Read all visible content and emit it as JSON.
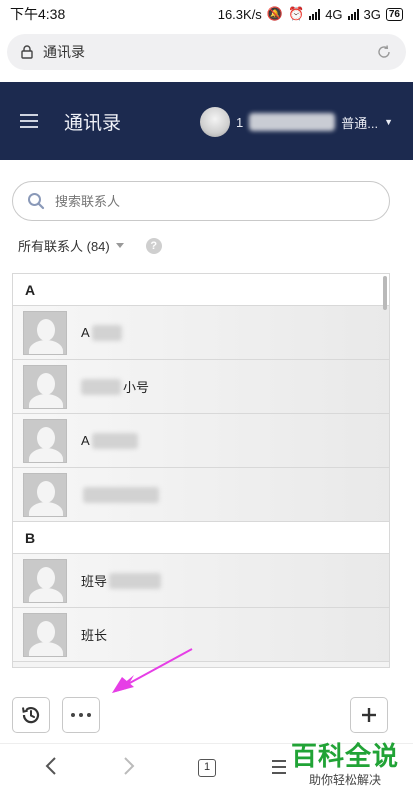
{
  "status_bar": {
    "time": "下午4:38",
    "speed": "16.3K/s",
    "net1": "4G",
    "net2": "3G",
    "battery": "76"
  },
  "browser": {
    "url_title": "通讯录"
  },
  "header": {
    "title": "通讯录",
    "user_prefix": "1",
    "user_suffix": "普通..."
  },
  "search": {
    "placeholder": "搜索联系人"
  },
  "filter": {
    "label": "所有联系人 (84)",
    "help": "?"
  },
  "groups": [
    {
      "letter": "A",
      "contacts": [
        {
          "visible_text": "A"
        },
        {
          "visible_text": "小号"
        },
        {
          "visible_text": "A"
        },
        {
          "visible_text": ""
        }
      ]
    },
    {
      "letter": "B",
      "contacts": [
        {
          "visible_text": "班导"
        },
        {
          "visible_text": "班长"
        }
      ]
    }
  ],
  "nav": {
    "tab_count": "1"
  },
  "watermark": {
    "main": "百科全说",
    "sub": "助你轻松解决"
  },
  "colors": {
    "header_bg": "#1c2a4f",
    "annotation": "#e63ee6",
    "watermark": "#21a336"
  }
}
